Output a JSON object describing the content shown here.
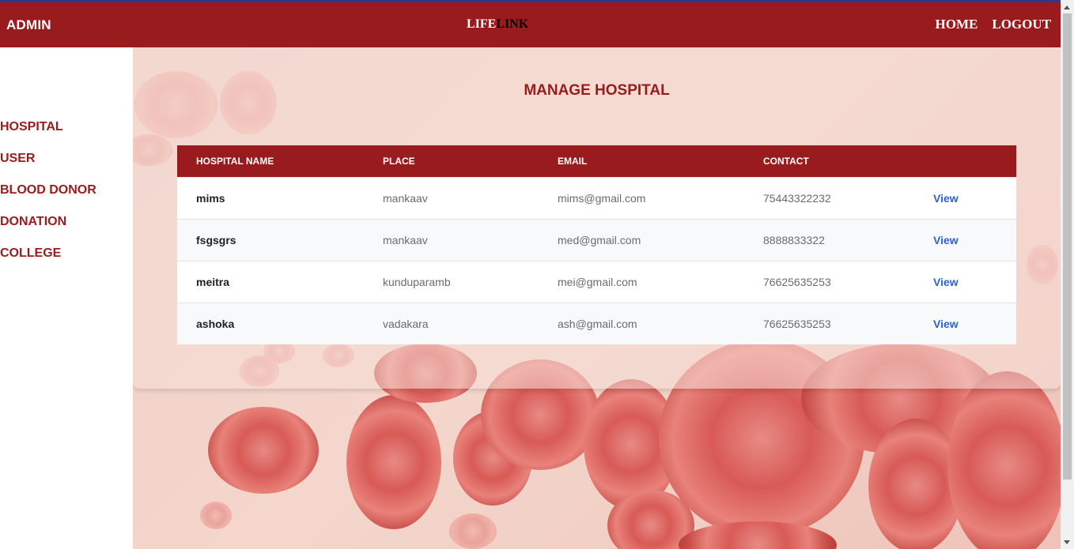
{
  "navbar": {
    "admin_label": "ADMIN",
    "logo_part1": "LIFE",
    "logo_part2": "LINK",
    "home_label": "HOME",
    "logout_label": "LOGOUT"
  },
  "sidebar": {
    "items": [
      {
        "label": "HOSPITAL"
      },
      {
        "label": "USER"
      },
      {
        "label": "BLOOD DONOR"
      },
      {
        "label": "DONATION"
      },
      {
        "label": "COLLEGE"
      }
    ]
  },
  "main": {
    "title": "MANAGE HOSPITAL",
    "columns": [
      "HOSPITAL NAME",
      "PLACE",
      "EMAIL",
      "CONTACT"
    ],
    "rows": [
      {
        "name": "mims",
        "place": "mankaav",
        "email": "mims@gmail.com",
        "contact": "75443322232",
        "action": "View"
      },
      {
        "name": "fsgsgrs",
        "place": "mankaav",
        "email": "med@gmail.com",
        "contact": "8888833322",
        "action": "View"
      },
      {
        "name": "meitra",
        "place": "kunduparamb",
        "email": "mei@gmail.com",
        "contact": "76625635253",
        "action": "View"
      },
      {
        "name": "ashoka",
        "place": "vadakara",
        "email": "ash@gmail.com",
        "contact": "76625635253",
        "action": "View"
      }
    ]
  },
  "colors": {
    "brand": "#991b1e",
    "link": "#2a62d8"
  }
}
